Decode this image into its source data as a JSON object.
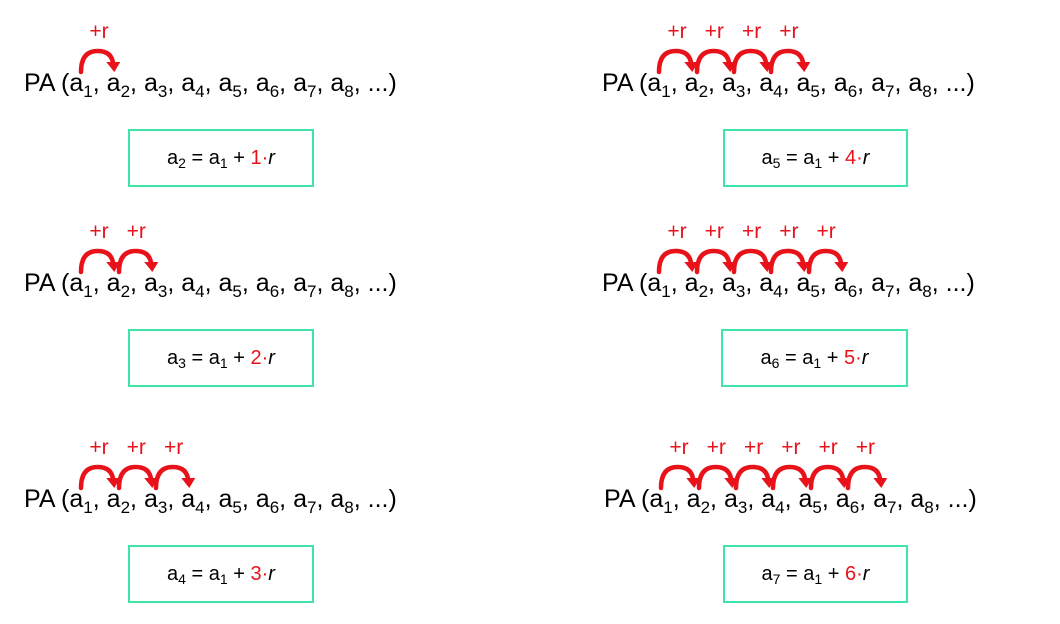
{
  "colors": {
    "accent_red": "#e8121a",
    "box_border": "#3ee6a7"
  },
  "sequence": {
    "prefix": "PA (",
    "terms": [
      {
        "base": "a",
        "sub": "1"
      },
      {
        "base": "a",
        "sub": "2"
      },
      {
        "base": "a",
        "sub": "3"
      },
      {
        "base": "a",
        "sub": "4"
      },
      {
        "base": "a",
        "sub": "5"
      },
      {
        "base": "a",
        "sub": "6"
      },
      {
        "base": "a",
        "sub": "7"
      },
      {
        "base": "a",
        "sub": "8"
      }
    ],
    "ellipsis": "...",
    "suffix": ")"
  },
  "step_label": "+r",
  "panels": [
    {
      "jumps": 1,
      "formula": {
        "lhs_base": "a",
        "lhs_sub": "2",
        "eq": " = ",
        "a1_base": "a",
        "a1_sub": "1",
        "plus": " + ",
        "coef": "1·",
        "r": "r"
      }
    },
    {
      "jumps": 2,
      "formula": {
        "lhs_base": "a",
        "lhs_sub": "3",
        "eq": " = ",
        "a1_base": "a",
        "a1_sub": "1",
        "plus": " + ",
        "coef": "2·",
        "r": "r"
      }
    },
    {
      "jumps": 3,
      "formula": {
        "lhs_base": "a",
        "lhs_sub": "4",
        "eq": " = ",
        "a1_base": "a",
        "a1_sub": "1",
        "plus": " + ",
        "coef": "3·",
        "r": "r"
      }
    },
    {
      "jumps": 4,
      "formula": {
        "lhs_base": "a",
        "lhs_sub": "5",
        "eq": " = ",
        "a1_base": "a",
        "a1_sub": "1",
        "plus": " + ",
        "coef": "4·",
        "r": "r"
      }
    },
    {
      "jumps": 5,
      "formula": {
        "lhs_base": "a",
        "lhs_sub": "6",
        "eq": " = ",
        "a1_base": "a",
        "a1_sub": "1",
        "plus": " + ",
        "coef": "5·",
        "r": "r"
      }
    },
    {
      "jumps": 6,
      "formula": {
        "lhs_base": "a",
        "lhs_sub": "7",
        "eq": " = ",
        "a1_base": "a",
        "a1_sub": "1",
        "plus": " + ",
        "coef": "6·",
        "r": "r"
      }
    }
  ]
}
